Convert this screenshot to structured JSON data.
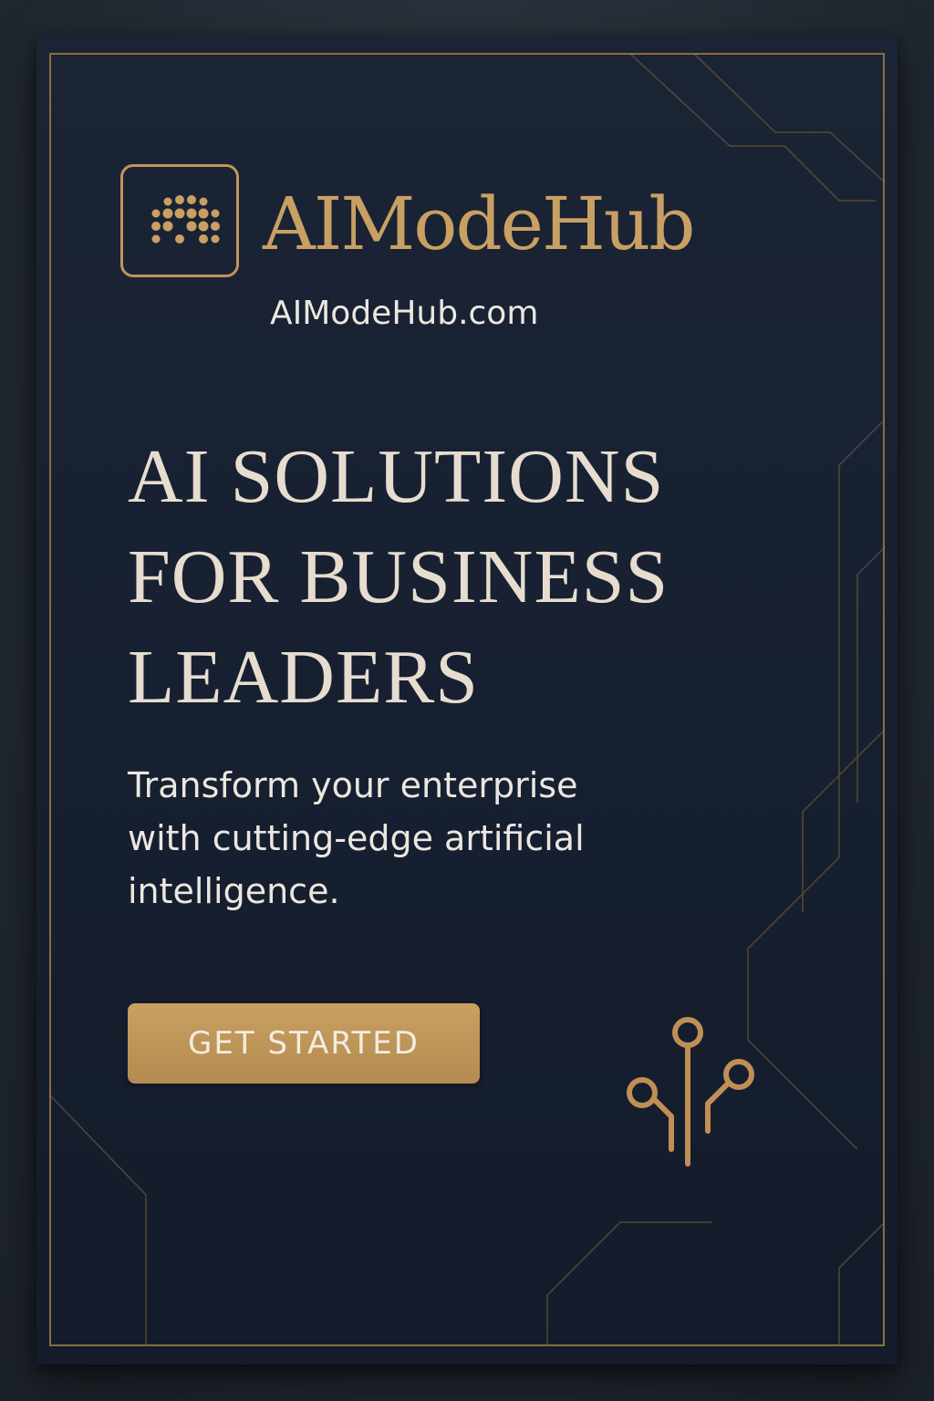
{
  "brand": {
    "name": "AIModeHub",
    "url": "AIModeHub.com"
  },
  "hero": {
    "headline_lines": [
      "AI SOLUTIONS",
      "FOR BUSINESS",
      "LEADERS"
    ],
    "subtext_lines": [
      "Transform your enterprise",
      "with cutting-edge artificial",
      "intelligence."
    ]
  },
  "cta": {
    "label": "GET STARTED"
  },
  "icons": {
    "logo": "dot-grid-logo-icon",
    "circuit": "circuit-nodes-icon"
  },
  "colors": {
    "background": "#1b2434",
    "accent_gold": "#c9a064",
    "headline": "#e6ddcf",
    "body_text": "#ece7df",
    "button": "#bf9458"
  }
}
